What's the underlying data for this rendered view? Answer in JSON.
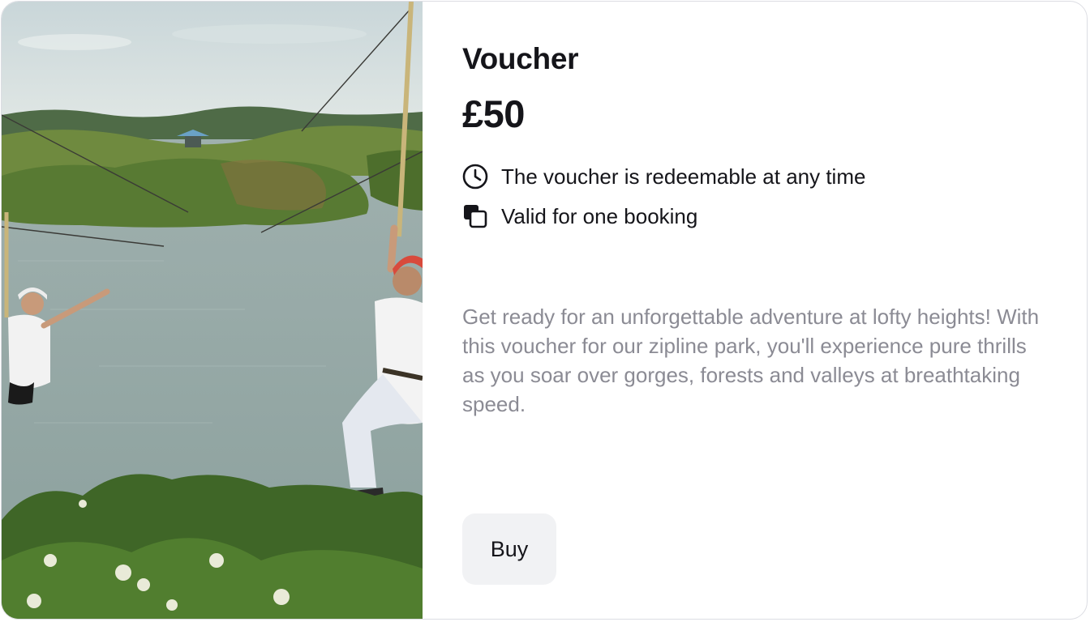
{
  "image": {
    "alt": "Two people riding a zipline over a lake surrounded by greenery"
  },
  "voucher": {
    "title": "Voucher",
    "price": "£50"
  },
  "features": [
    {
      "icon": "clock-icon",
      "text": "The voucher is redeemable at any time"
    },
    {
      "icon": "copy-icon",
      "text": "Valid for one booking"
    }
  ],
  "description": "Get ready for an unforgettable adventure at lofty heights! With this voucher for our zipline park, you'll experience pure thrills as you soar over gorges, forests and valleys at breathtaking speed.",
  "actions": {
    "buy_label": "Buy"
  },
  "colors": {
    "text": "#15151a",
    "muted": "#8b8b94",
    "button_bg": "#f1f2f4",
    "border": "#dcdde3"
  }
}
